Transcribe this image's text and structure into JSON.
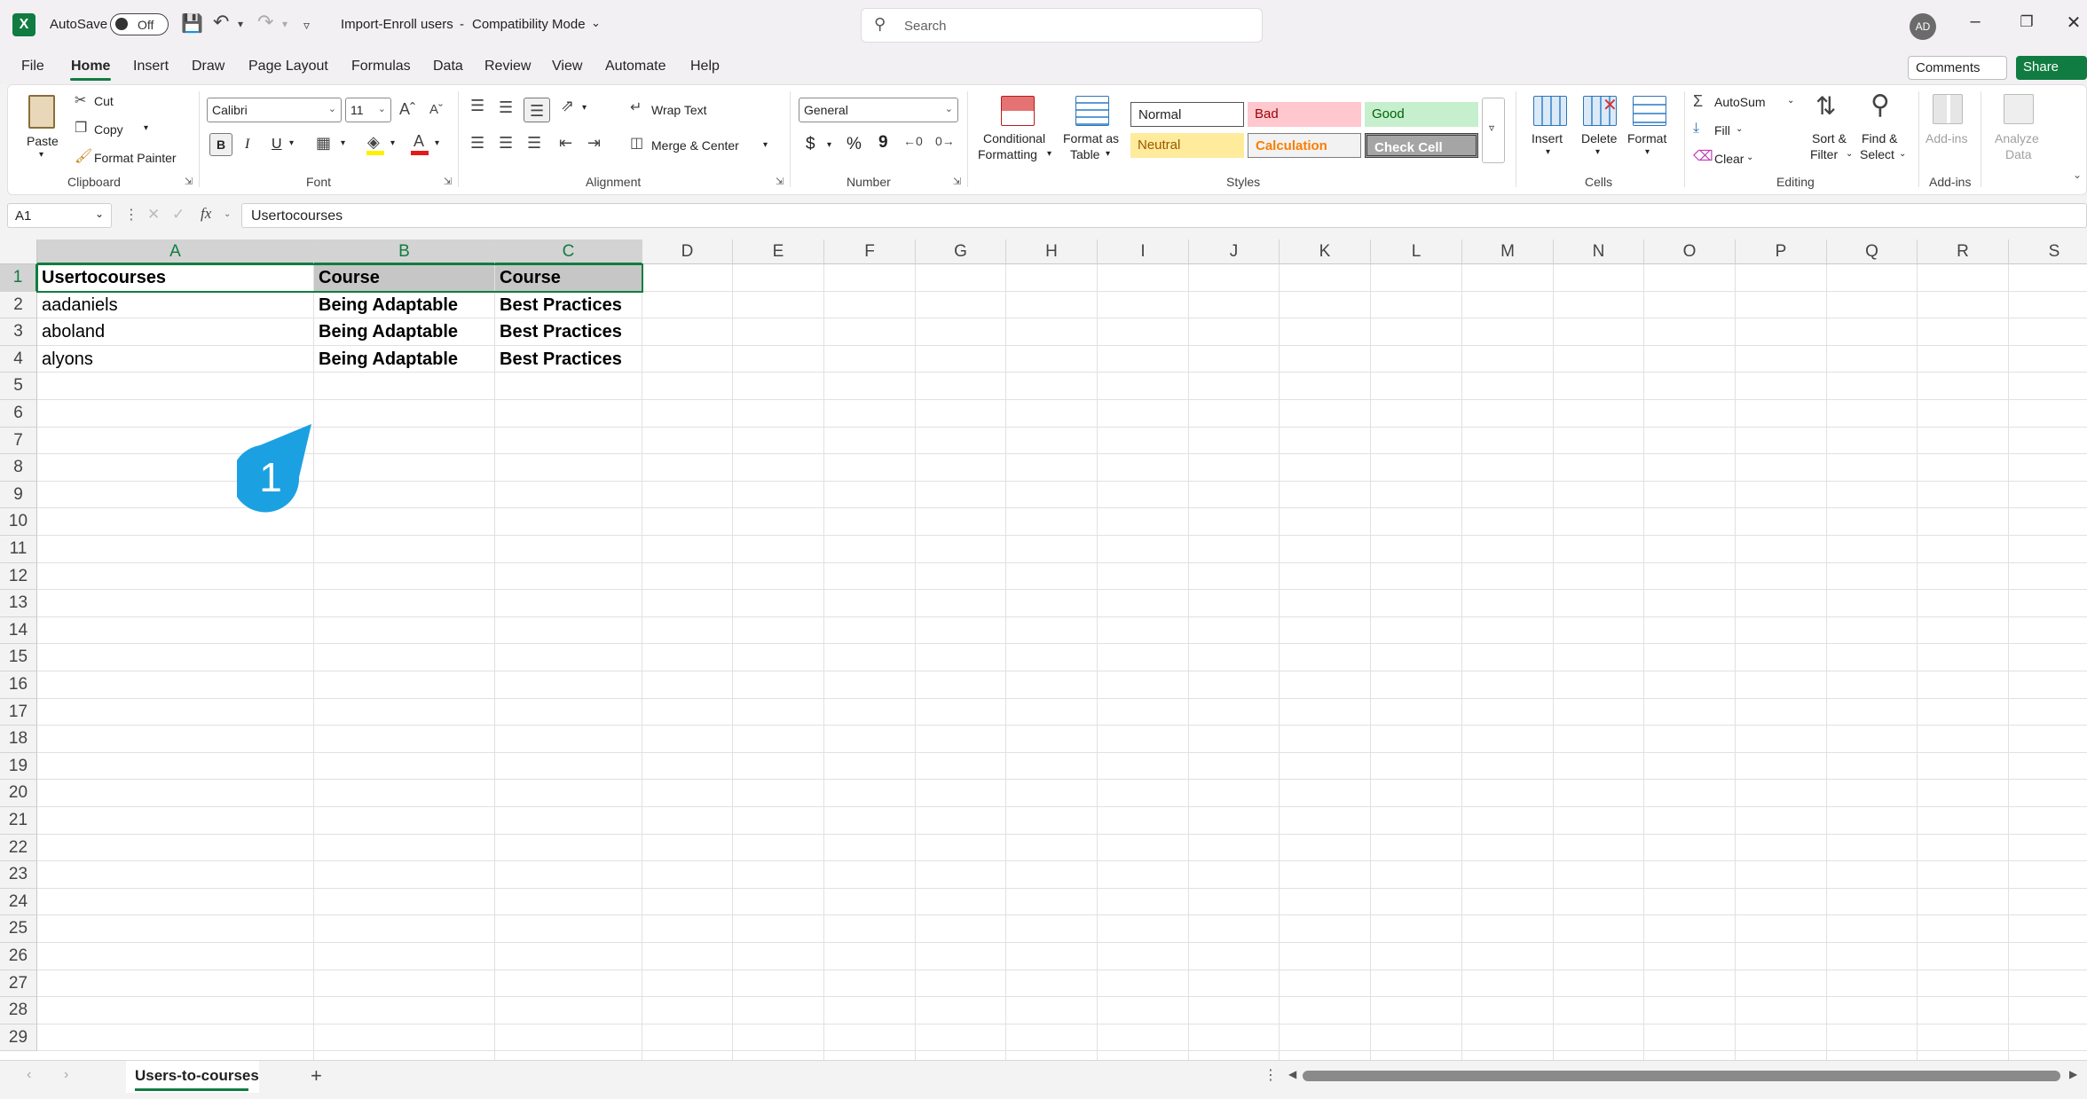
{
  "titlebar": {
    "autosave_label": "AutoSave",
    "autosave_state": "Off",
    "file_title": "Import-Enroll users",
    "separator": "-",
    "mode": "Compatibility Mode",
    "search_placeholder": "Search",
    "avatar_initials": "AD"
  },
  "menu": {
    "tabs": [
      "File",
      "Home",
      "Insert",
      "Draw",
      "Page Layout",
      "Formulas",
      "Data",
      "Review",
      "View",
      "Automate",
      "Help"
    ],
    "active": "Home",
    "comments_label": "Comments",
    "share_label": "Share"
  },
  "ribbon": {
    "clipboard": {
      "paste": "Paste",
      "cut": "Cut",
      "copy": "Copy",
      "format_painter": "Format Painter",
      "label": "Clipboard"
    },
    "font": {
      "name": "Calibri",
      "size": "11",
      "bold": "B",
      "italic": "I",
      "underline": "U",
      "label": "Font"
    },
    "alignment": {
      "wrap_text": "Wrap Text",
      "merge_center": "Merge & Center",
      "label": "Alignment"
    },
    "number": {
      "format": "General",
      "currency": "$",
      "percent": "%",
      "comma": "9",
      "label": "Number"
    },
    "styles": {
      "conditional_formatting_1": "Conditional",
      "conditional_formatting_2": "Formatting",
      "format_as_table_1": "Format as",
      "format_as_table_2": "Table",
      "normal": "Normal",
      "bad": "Bad",
      "good": "Good",
      "neutral": "Neutral",
      "calculation": "Calculation",
      "check_cell": "Check Cell",
      "label": "Styles"
    },
    "cells": {
      "insert": "Insert",
      "delete": "Delete",
      "format": "Format",
      "label": "Cells"
    },
    "editing": {
      "autosum": "AutoSum",
      "fill": "Fill",
      "clear": "Clear",
      "sort_1": "Sort &",
      "sort_2": "Filter",
      "find_1": "Find &",
      "find_2": "Select",
      "label": "Editing"
    },
    "addins": {
      "addins": "Add-ins",
      "analyze_1": "Analyze",
      "analyze_2": "Data",
      "label": "Add-ins"
    }
  },
  "formula_bar": {
    "name_box": "A1",
    "fx": "fx",
    "content": "Usertocourses"
  },
  "sheet": {
    "columns": [
      "A",
      "B",
      "C",
      "D",
      "E",
      "F",
      "G",
      "H",
      "I",
      "J",
      "K",
      "L",
      "M",
      "N",
      "O",
      "P",
      "Q",
      "R",
      "S"
    ],
    "rows": [
      "1",
      "2",
      "3",
      "4",
      "5",
      "6",
      "7",
      "8",
      "9",
      "10",
      "11",
      "12",
      "13",
      "14",
      "15",
      "16",
      "17",
      "18",
      "19",
      "20",
      "21",
      "22",
      "23",
      "24",
      "25",
      "26",
      "27",
      "28",
      "29"
    ],
    "cells": [
      [
        "Usertocourses",
        "Course",
        "Course"
      ],
      [
        "aadaniels",
        "Being Adaptable",
        "Best Practices"
      ],
      [
        "aboland",
        "Being Adaptable",
        "Best Practices"
      ],
      [
        "alyons",
        "Being Adaptable",
        "Best Practices"
      ]
    ],
    "selected_cell": "A1"
  },
  "callout": {
    "number": "1",
    "color": "#1ba1e2"
  },
  "tabs": {
    "sheet_name": "Users-to-courses",
    "add": "+"
  },
  "colors": {
    "accent": "#107c41"
  }
}
